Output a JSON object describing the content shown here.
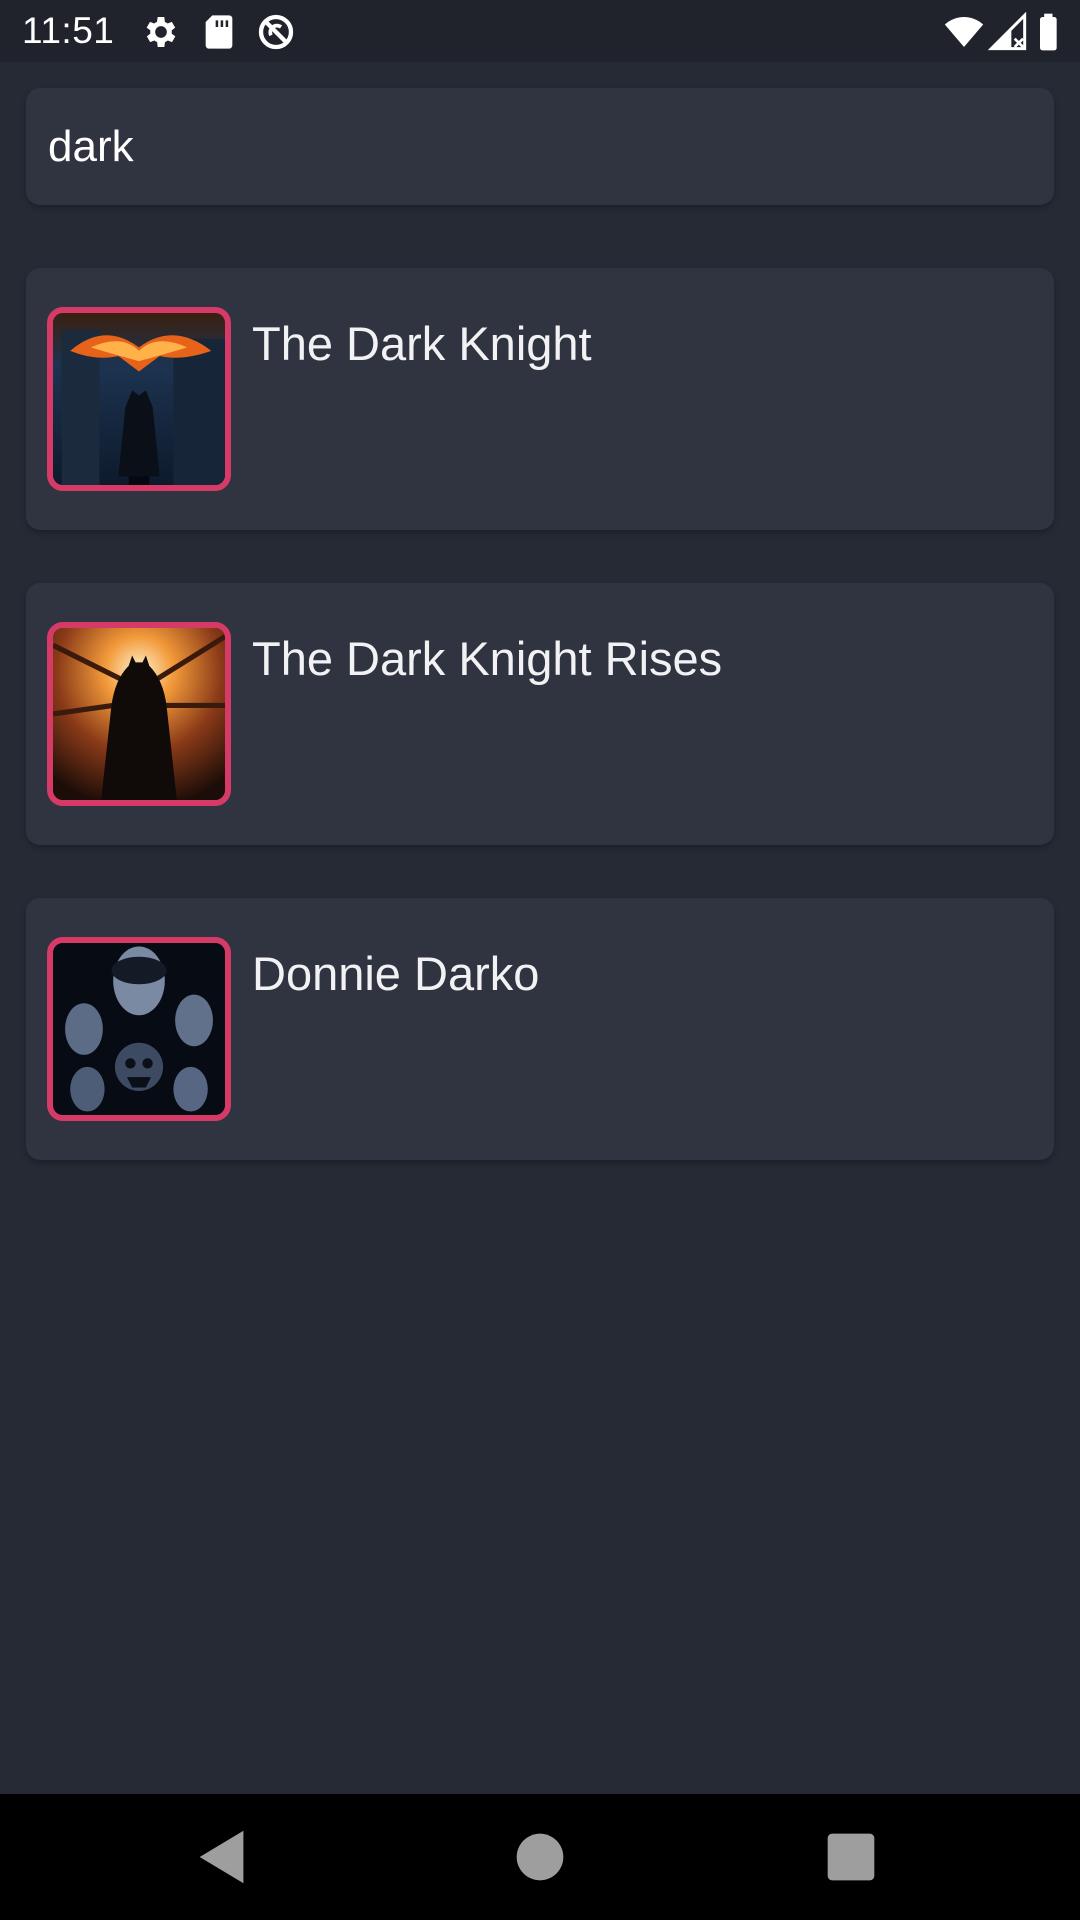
{
  "status_bar": {
    "time": "11:51",
    "left_icons": [
      "settings-gear-icon",
      "sd-card-icon",
      "no-sync-icon"
    ],
    "right_icons": [
      "wifi-icon",
      "cellular-signal-icon",
      "battery-icon"
    ]
  },
  "search": {
    "value": "dark",
    "placeholder": ""
  },
  "results": [
    {
      "title": "The Dark Knight",
      "poster": "poster-the-dark-knight"
    },
    {
      "title": "The Dark Knight Rises",
      "poster": "poster-the-dark-knight-rises"
    },
    {
      "title": "Donnie Darko",
      "poster": "poster-donnie-darko"
    }
  ],
  "nav_bar": {
    "icons": [
      "back-triangle-icon",
      "home-circle-icon",
      "recents-square-icon"
    ]
  },
  "colors": {
    "background": "#262a35",
    "card": "#303340",
    "accent_border": "#d63a66",
    "text": "#f2f2f4"
  }
}
